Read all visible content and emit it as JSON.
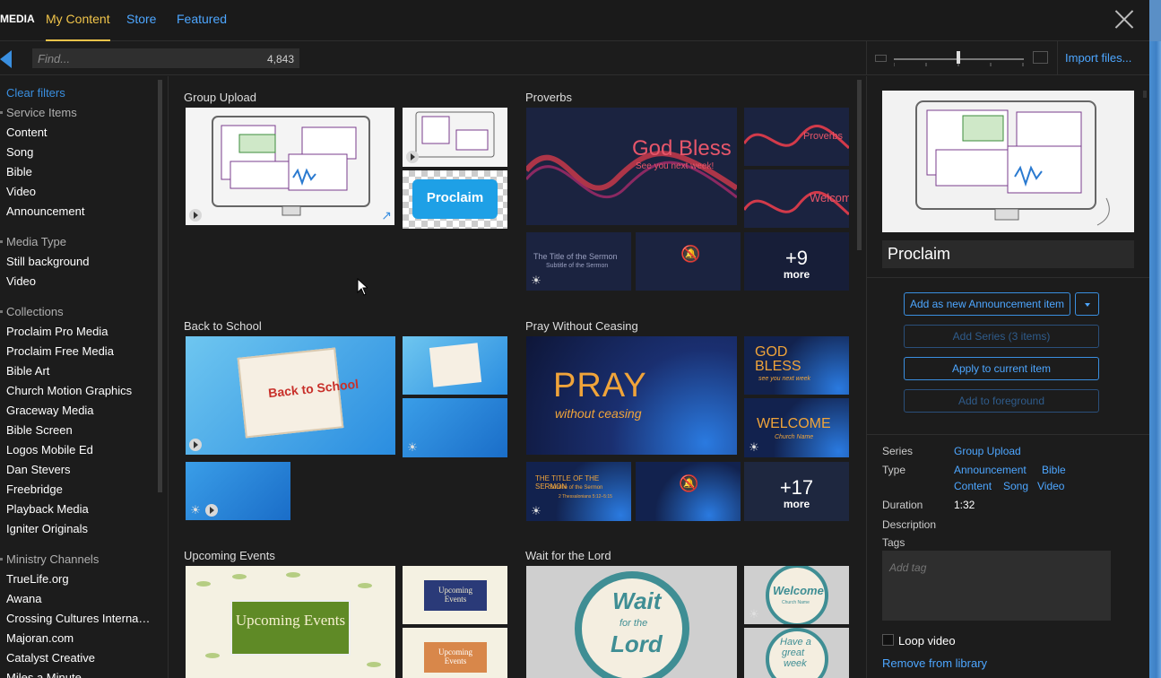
{
  "app": {
    "brand": "MEDIA"
  },
  "tabs": [
    {
      "label": "My Content",
      "active": true
    },
    {
      "label": "Store"
    },
    {
      "label": "Featured"
    }
  ],
  "search": {
    "placeholder": "Find...",
    "count": "4,843"
  },
  "toolbar": {
    "import_label": "Import files..."
  },
  "sidebar": {
    "clear_filters": "Clear filters",
    "service_items_title": "Service Items",
    "service_items": [
      "Content",
      "Song",
      "Bible",
      "Video",
      "Announcement"
    ],
    "media_type_title": "Media Type",
    "media_types": [
      "Still background",
      "Video"
    ],
    "collections_title": "Collections",
    "collections": [
      "Proclaim Pro Media",
      "Proclaim Free Media",
      "Bible Art",
      "Church Motion Graphics",
      "Graceway Media",
      "Bible Screen",
      "Logos Mobile Ed",
      "Dan Stevers",
      "Freebridge",
      "Playback Media",
      "Igniter Originals"
    ],
    "ministry_title": "Ministry Channels",
    "ministry": [
      "TrueLife.org",
      "Awana",
      "Crossing Cultures Interna…",
      "Majoran.com",
      "Catalyst Creative",
      "Miles a Minute"
    ]
  },
  "groups": [
    {
      "title": "Group Upload",
      "tiles": [
        "Proclaim"
      ]
    },
    {
      "title": "Proverbs",
      "tiles": [
        "God Bless",
        "See you next week!",
        "Proverbs",
        "Welcome",
        "The Title of the Sermon",
        "Subtitle of the Sermon",
        "+9",
        "more"
      ]
    },
    {
      "title": "Back to School",
      "tiles": [
        "Back to School"
      ]
    },
    {
      "title": "Pray Without Ceasing",
      "tiles": [
        "PRAY",
        "without ceasing",
        "GOD",
        "BLESS",
        "see you next week",
        "WELCOME",
        "Church Name",
        "THE TITLE OF THE SERMON",
        "Subtitle of the Sermon",
        "2 Thessalonians 5:12–5:15",
        "+17",
        "more"
      ]
    },
    {
      "title": "Upcoming Events",
      "tiles": [
        "Upcoming Events",
        "Upcoming",
        "Events",
        "Upcoming",
        "Events"
      ]
    },
    {
      "title": "Wait for the Lord",
      "tiles": [
        "Wait",
        "for the",
        "Lord",
        "Welcome",
        "Church Name",
        "Have a",
        "great",
        "week"
      ]
    }
  ],
  "detail": {
    "title": "Proclaim",
    "buttons": {
      "add_announcement": "Add as new Announcement item",
      "add_series": "Add Series (3 items)",
      "apply_current": "Apply to current item",
      "add_foreground": "Add to foreground"
    },
    "series_label": "Series",
    "series_value": "Group Upload",
    "type_label": "Type",
    "types": [
      "Announcement",
      "Bible",
      "Content",
      "Song",
      "Video"
    ],
    "duration_label": "Duration",
    "duration_value": "1:32",
    "description_label": "Description",
    "tags_label": "Tags",
    "tags_placeholder": "Add tag",
    "loop_label": "Loop video",
    "remove_label": "Remove from library"
  },
  "colors": {
    "accent": "#4da6ff",
    "active_tab": "#f0c44a",
    "background": "#1c1c1c"
  }
}
